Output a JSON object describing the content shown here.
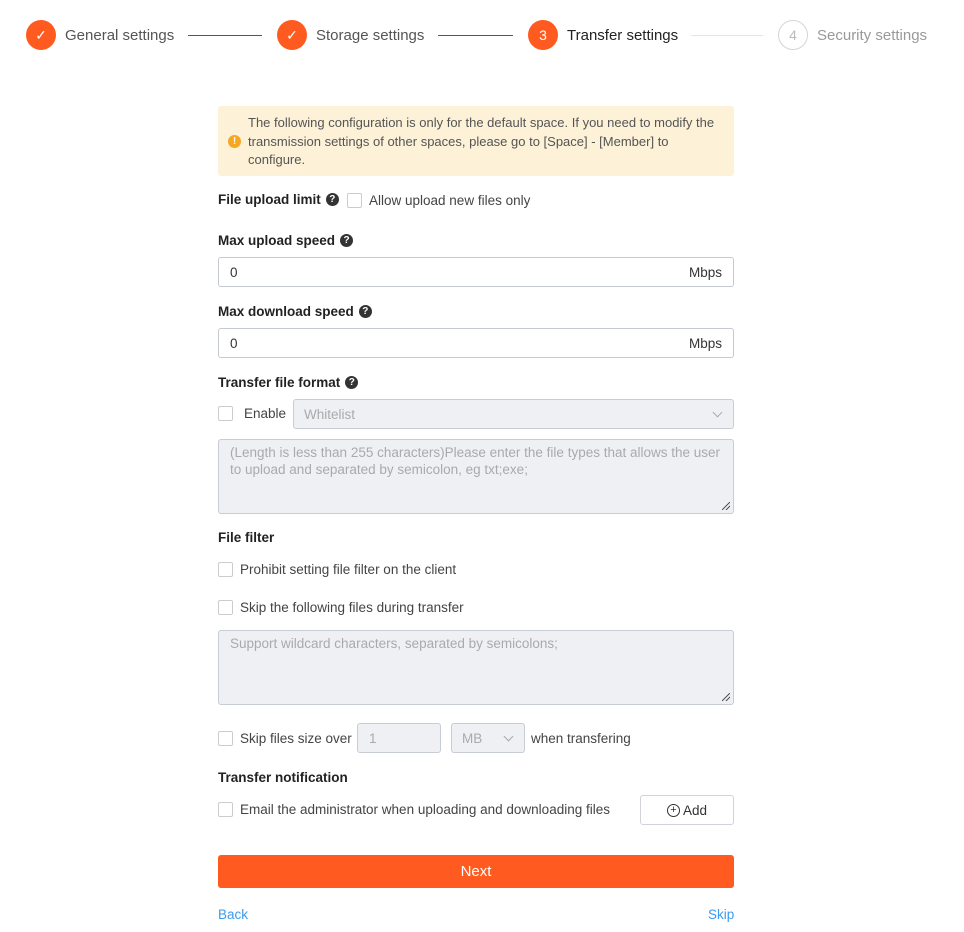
{
  "steps": [
    {
      "number": "1",
      "label": "General settings",
      "state": "done"
    },
    {
      "number": "2",
      "label": "Storage settings",
      "state": "done"
    },
    {
      "number": "3",
      "label": "Transfer settings",
      "state": "active"
    },
    {
      "number": "4",
      "label": "Security settings",
      "state": "todo"
    }
  ],
  "alert": {
    "icon": "warning-icon",
    "text": "The following configuration is only for the default space. If you need to modify the transmission settings of other spaces, please go to [Space] - [Member] to configure."
  },
  "file_upload_limit": {
    "label": "File upload limit",
    "checkbox_label": "Allow upload new files only",
    "checked": false
  },
  "max_upload": {
    "label": "Max upload speed",
    "value": "0",
    "unit": "Mbps"
  },
  "max_download": {
    "label": "Max download speed",
    "value": "0",
    "unit": "Mbps"
  },
  "transfer_format": {
    "label": "Transfer file format",
    "enable_label": "Enable",
    "enabled": false,
    "mode": "Whitelist",
    "placeholder": "(Length is less than 255 characters)Please enter the file types that allows the user to upload and separated by semicolon, eg txt;exe;"
  },
  "file_filter": {
    "label": "File filter",
    "prohibit_label": "Prohibit setting file filter on the client",
    "skip_label": "Skip the following files during transfer",
    "skip_placeholder": "Support wildcard characters, separated by semicolons;",
    "size_label": "Skip files size over",
    "size_value": "1",
    "size_unit": "MB",
    "size_suffix": "when transfering"
  },
  "notification": {
    "label": "Transfer notification",
    "email_label": "Email the administrator when uploading and downloading files",
    "add_label": "Add"
  },
  "actions": {
    "next": "Next",
    "back": "Back",
    "skip": "Skip"
  },
  "colors": {
    "accent": "#ff5a1f",
    "link": "#3a9bf0",
    "alert_bg": "#fdf1d8"
  }
}
